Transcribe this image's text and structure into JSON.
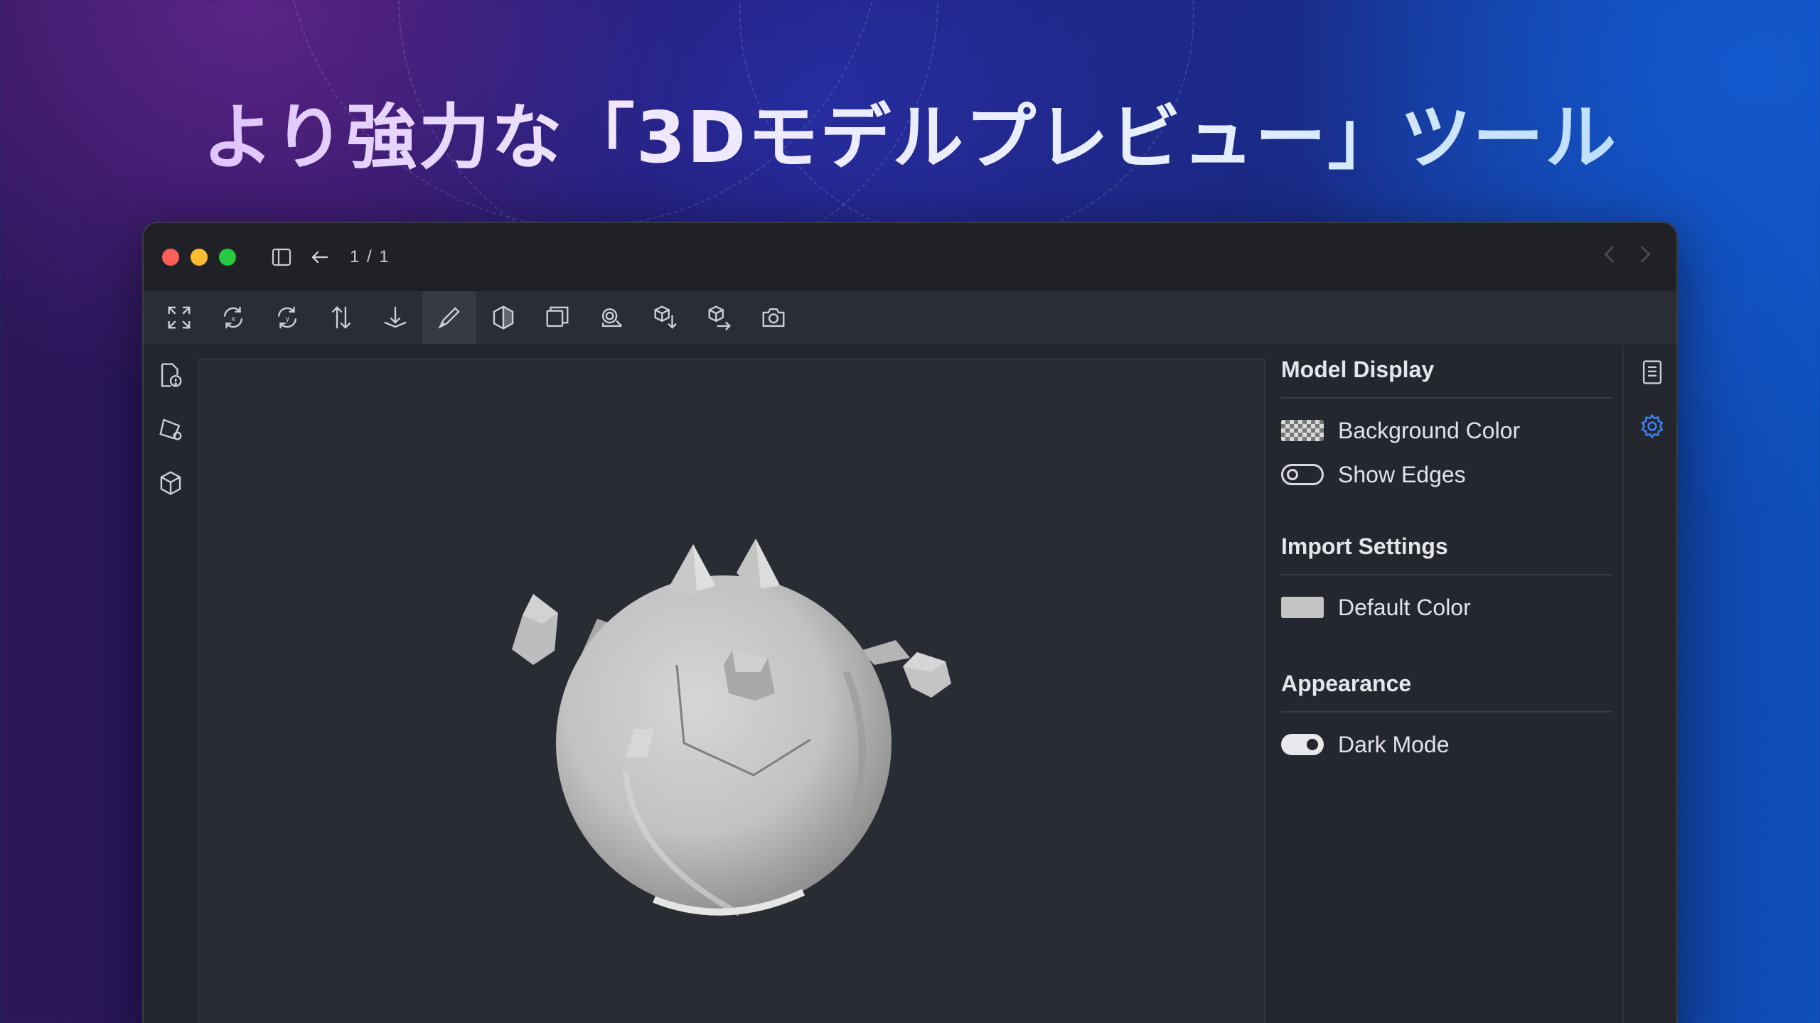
{
  "headline": "より強力な「3Dモデルプレビュー」ツール",
  "titlebar": {
    "page_count": "1 / 1"
  },
  "toolbar": {
    "tools": [
      "fullscreen-icon",
      "rotate-x-icon",
      "rotate-y-icon",
      "flip-vertical-icon",
      "move-down-icon",
      "pen-icon",
      "half-shade-icon",
      "cube-face-icon",
      "stacked-shapes-icon",
      "cube-down-icon",
      "cube-right-icon",
      "camera-icon"
    ],
    "active_tool": "pen-icon"
  },
  "left_rail": [
    "file-info-icon",
    "shapes-icon",
    "cube-icon"
  ],
  "settings": {
    "model_display": {
      "title": "Model Display",
      "background_color_label": "Background Color",
      "show_edges_label": "Show Edges",
      "show_edges_on": false
    },
    "import_settings": {
      "title": "Import Settings",
      "default_color_label": "Default Color",
      "default_color": "#c4c4c4"
    },
    "appearance": {
      "title": "Appearance",
      "dark_mode_label": "Dark Mode",
      "dark_mode_on": true
    }
  },
  "right_rail": [
    "document-list-icon",
    "gear-icon"
  ],
  "colors": {
    "accent": "#3b82f6",
    "close": "#fe5f57",
    "minimize": "#febc2e",
    "zoom": "#28c840"
  }
}
